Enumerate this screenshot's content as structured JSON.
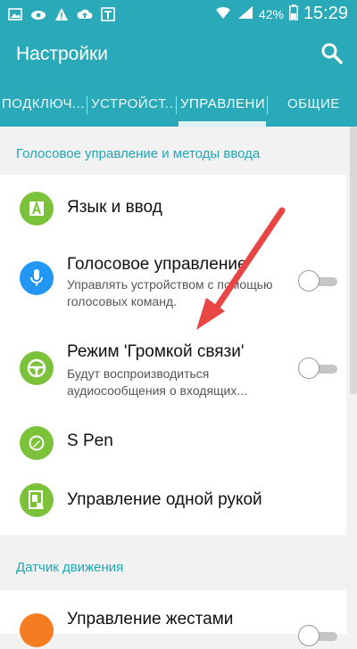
{
  "status": {
    "battery": "42%",
    "time": "15:29"
  },
  "appbar": {
    "title": "Настройки"
  },
  "tabs": [
    {
      "label": "ПОДКЛЮЧ..."
    },
    {
      "label": "УСТРОЙСТ..."
    },
    {
      "label": "УПРАВЛЕНИЕ"
    },
    {
      "label": "ОБЩИЕ"
    }
  ],
  "section1": {
    "title": "Голосовое управление и методы ввода"
  },
  "items": [
    {
      "title": "Язык и ввод",
      "sub": ""
    },
    {
      "title": "Голосовое управление",
      "sub": "Управлять устройством с помощью голосовых команд."
    },
    {
      "title": "Режим 'Громкой связи'",
      "sub": "Будут воспроизводиться аудиосообщения о входящих..."
    },
    {
      "title": "S Pen",
      "sub": ""
    },
    {
      "title": "Управление одной рукой",
      "sub": ""
    }
  ],
  "section2": {
    "title": "Датчик движения"
  },
  "items2": [
    {
      "title": "Управление жестами"
    }
  ],
  "colors": {
    "accent": "#2aa9b8",
    "green": "#7cc13a",
    "blue": "#2196f3",
    "orange": "#f57c20",
    "arrow": "#e84545"
  },
  "icons": {
    "a": "language-icon",
    "b": "microphone-icon",
    "c": "steering-wheel-icon",
    "d": "pen-icon",
    "e": "one-hand-icon",
    "f": "gesture-icon"
  }
}
